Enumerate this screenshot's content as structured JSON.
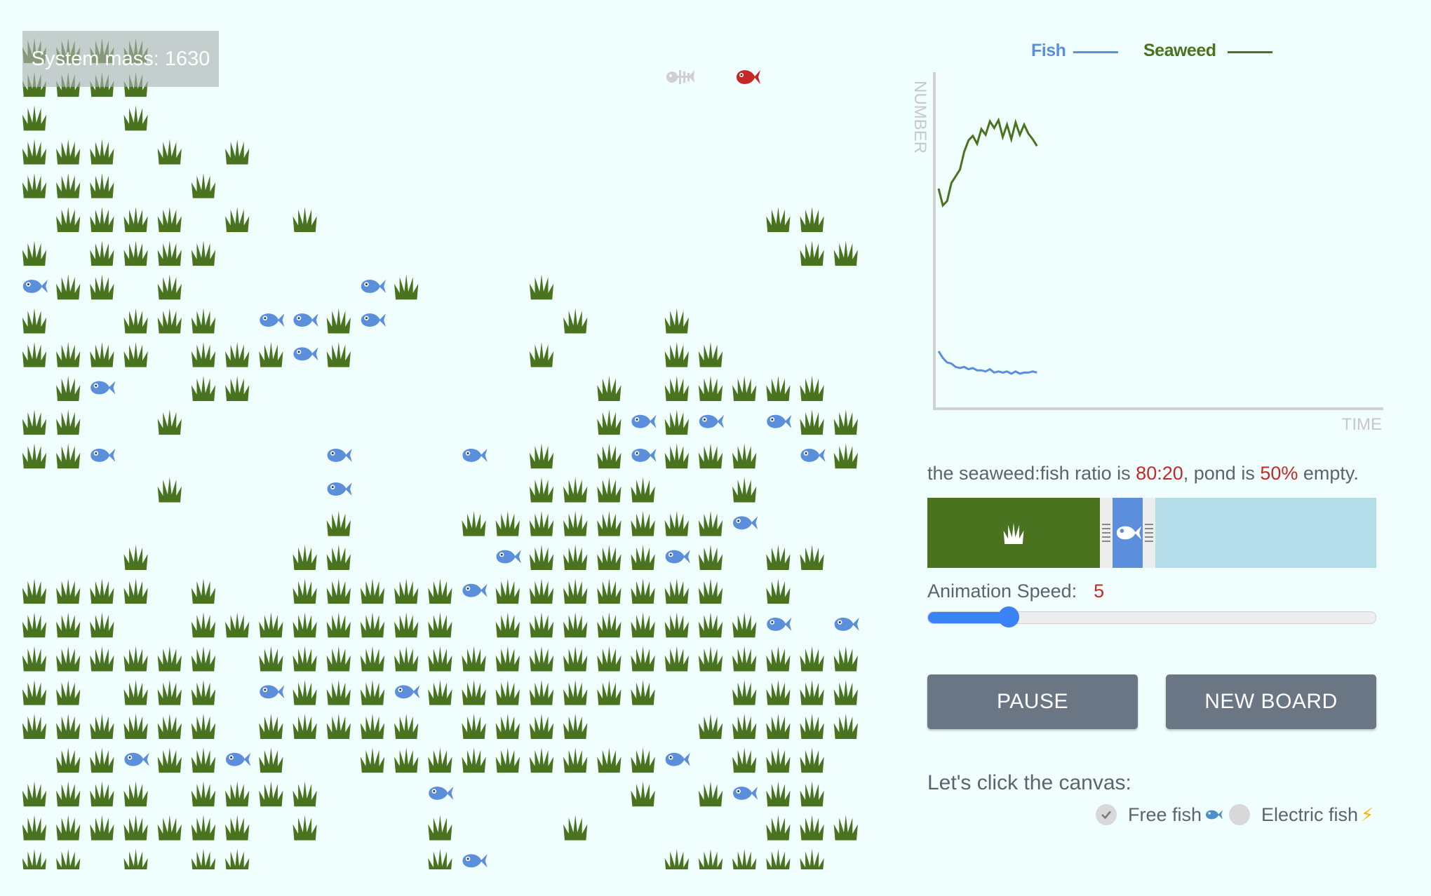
{
  "system_mass": {
    "label": "System mass: 1630"
  },
  "legend": {
    "fish": "Fish",
    "seaweed": "Seaweed"
  },
  "colors": {
    "fish": "#5b8fdc",
    "seaweed": "#4a7320",
    "water": "#b5dde9",
    "accent_red": "#c62828",
    "background": "#f0fffd",
    "button": "#6b7685"
  },
  "header_icons": [
    "fish-skeleton-icon",
    "red-fish-icon"
  ],
  "chart_data": {
    "type": "line",
    "xlabel": "TIME",
    "ylabel": "NUMBER",
    "grid": false,
    "legend_position": "top-center",
    "series": [
      {
        "name": "Seaweed",
        "values": [
          165,
          150,
          154,
          170,
          176,
          182,
          198,
          208,
          212,
          205,
          218,
          213,
          225,
          219,
          226,
          211,
          222,
          209,
          224,
          213,
          222,
          214,
          209,
          203
        ]
      },
      {
        "name": "Fish",
        "values": [
          20,
          14,
          10,
          9,
          6,
          5,
          6,
          4,
          5,
          3,
          3,
          2,
          4,
          1,
          2,
          1,
          2,
          0,
          2,
          0,
          1,
          1,
          2,
          1
        ]
      }
    ]
  },
  "ratio": {
    "prefix": "the seaweed:fish ratio is ",
    "value": "80:20",
    "middle": ", pond is ",
    "empty": "50%",
    "suffix": " empty.",
    "seaweed_fraction": 0.385,
    "fish_fraction": 0.067
  },
  "speed": {
    "label": "Animation Speed:",
    "value": "5",
    "level": 0.18
  },
  "buttons": {
    "pause": "PAUSE",
    "new_board": "NEW BOARD"
  },
  "click_prompt": "Let's click the canvas:",
  "options": [
    {
      "label": "Free fish",
      "checked": true,
      "icon": "fish-emoji-icon"
    },
    {
      "label": "Electric fish",
      "checked": false,
      "icon": "lightning-icon"
    }
  ],
  "grid": [
    "SSSS........................",
    "SSSS........................",
    "S..S........................",
    "SSS.S.S.....................",
    "SSS..S......................",
    ".SSSS.S.S.............SS....",
    "S.SSSS.................SS...",
    "FSS.S.....FS...S............",
    "S..SSS.FFSF.....S..S........",
    "SSSS.SSSFS.....S...SS.......",
    ".SF..SS..........S.SSSSS....",
    "SS..S............SFSF.FSSS..",
    "SSF......F...F.S.SFSSS.FS...",
    "....S....F.....SSSS..S......",
    ".........S...SSSSSSSSF......",
    "...S....SS....FSSSSFS.SS....",
    "SSSS.S..SSSSSFSSSSSSS.S.....",
    "SSS..SSSSSSSS.SSSSSSSSF.F...",
    "SSSSSS.SSSSSSSSSSSSSSSSSS...",
    "SS.SSS.FSSSFSSSSSSS..SSSS...",
    "SSSSSS.SSSSS.SSSS...SSSSS...",
    ".SSFSSFS..SSSSSSSSSF.SSS....",
    "SSSS.SSSS...F.....S.SFSS....",
    "SSSSSSS.S...S...S.....SSS...",
    "SS.S.SS.....SF.....SSSSS.S.."
  ]
}
